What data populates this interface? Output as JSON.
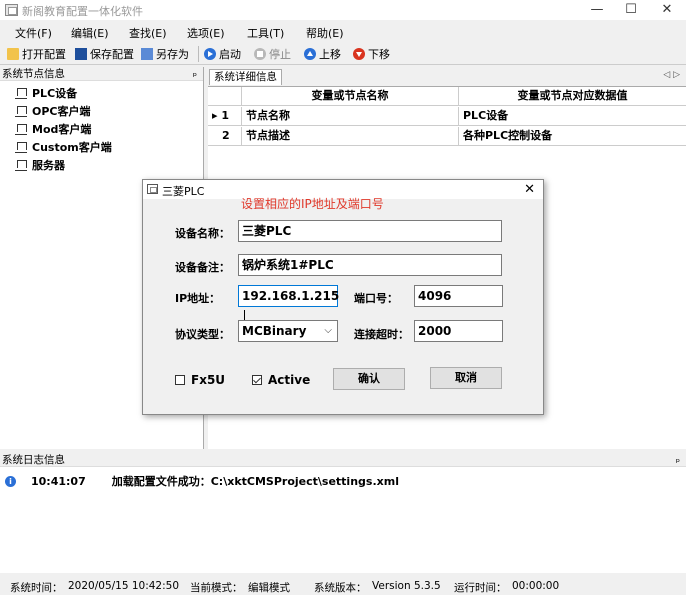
{
  "window": {
    "title": "新阁教育配置一体化软件"
  },
  "menu": [
    {
      "label": "文件(F)"
    },
    {
      "label": "编辑(E)"
    },
    {
      "label": "查找(E)"
    },
    {
      "label": "选项(E)"
    },
    {
      "label": "工具(T)"
    },
    {
      "label": "帮助(E)"
    }
  ],
  "toolbar": {
    "open": "打开配置",
    "save": "保存配置",
    "saveas": "另存为",
    "start": "启动",
    "stop": "停止",
    "up": "上移",
    "down": "下移"
  },
  "left_panel": {
    "title": "系统节点信息",
    "pin": "ₚ",
    "items": [
      {
        "label": "PLC设备"
      },
      {
        "label": "OPC客户端"
      },
      {
        "label": "Mod客户端"
      },
      {
        "label": "Custom客户端"
      },
      {
        "label": "服务器"
      }
    ]
  },
  "right_panel": {
    "tab": "系统详细信息",
    "arrows": "◁ ▷",
    "columns": [
      "变量或节点名称",
      "变量或节点对应数据值"
    ],
    "rows": [
      {
        "marker": "▸",
        "index": "1",
        "name": "节点名称",
        "value": "PLC设备"
      },
      {
        "marker": "",
        "index": "2",
        "name": "节点描述",
        "value": "各种PLC控制设备"
      }
    ]
  },
  "log_panel": {
    "title": "系统日志信息",
    "pin": "ₚ",
    "entries": [
      {
        "time": "10:41:07",
        "message": "加载配置文件成功：C:\\xktCMSProject\\settings.xml"
      }
    ]
  },
  "status": {
    "time_label": "系统时间：",
    "time": "2020/05/15 10:42:50",
    "mode_label": "当前模式：",
    "mode": "编辑模式",
    "version_label": "系统版本：",
    "version": "Version  5.3.5",
    "runtime_label": "运行时间：",
    "runtime": "00:00:00"
  },
  "dialog": {
    "title": "三菱PLC",
    "note": "设置相应的IP地址及端口号",
    "name_label": "设备名称：",
    "name_value": "三菱PLC",
    "remark_label": "设备备注：",
    "remark_value": "锅炉系统1#PLC",
    "ip_label": "IP地址：",
    "ip_value": "192.168.1.215",
    "port_label": "端口号：",
    "port_value": "4096",
    "protocol_label": "协议类型：",
    "protocol_value": "MCBinary",
    "timeout_label": "连接超时：",
    "timeout_value": "2000",
    "fx5u_label": "Fx5U",
    "fx5u_checked": false,
    "active_label": "Active",
    "active_checked": true,
    "confirm": "确认",
    "cancel": "取消"
  },
  "colors": {
    "accent": "#2a6fd6",
    "note": "#e0392b",
    "focus": "#0078d7"
  }
}
